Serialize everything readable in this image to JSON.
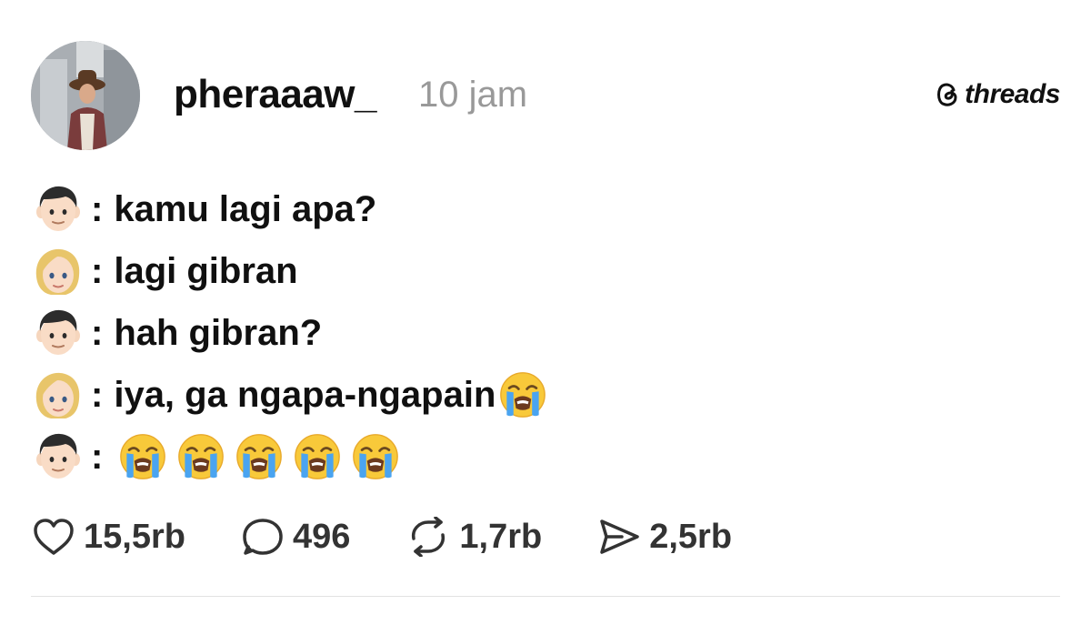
{
  "post": {
    "username": "pheraaaw_",
    "timestamp": "10 jam",
    "brand": "threads",
    "lines": [
      {
        "speaker": "boy-emoji",
        "text": "kamu lagi apa?"
      },
      {
        "speaker": "girl-emoji",
        "text": "lagi gibran"
      },
      {
        "speaker": "boy-emoji",
        "text": "hah gibran?"
      },
      {
        "speaker": "girl-emoji",
        "text": "iya, ga ngapa-ngapain",
        "trailing_emoji": "loudly-crying-face"
      },
      {
        "speaker": "boy-emoji",
        "text": "",
        "emojis": [
          "loudly-crying-face",
          "loudly-crying-face",
          "loudly-crying-face",
          "loudly-crying-face",
          "loudly-crying-face"
        ]
      }
    ],
    "colon": ":"
  },
  "actions": {
    "likes": "15,5rb",
    "replies": "496",
    "reposts": "1,7rb",
    "shares": "2,5rb"
  }
}
